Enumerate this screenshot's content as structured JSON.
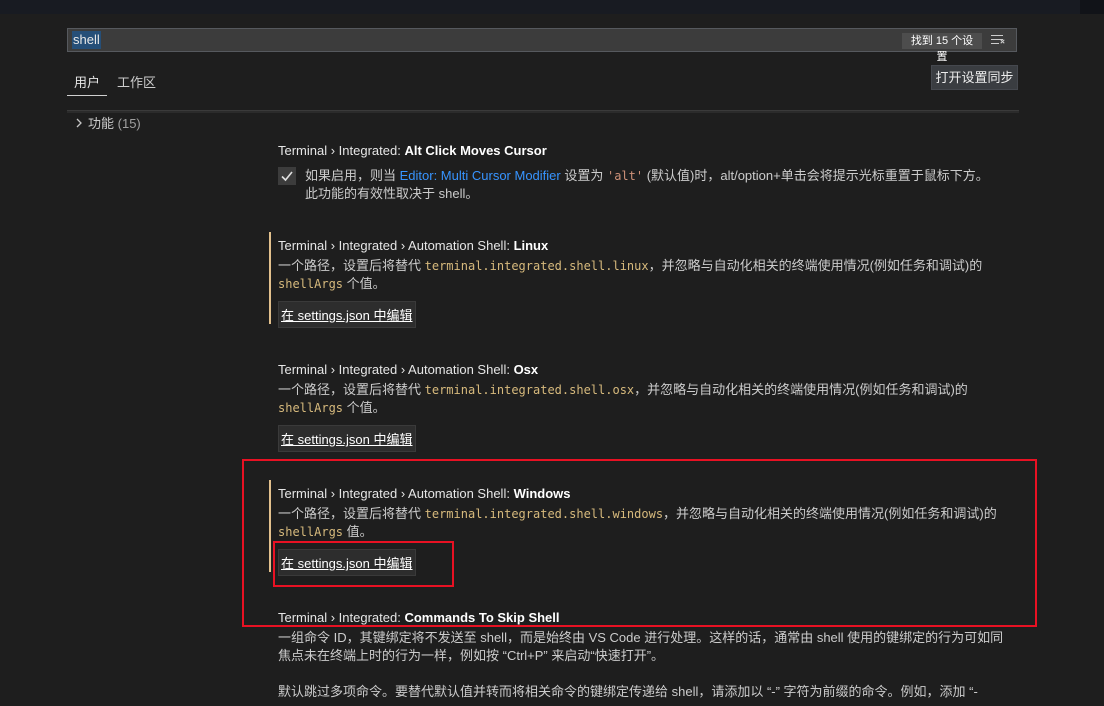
{
  "search": {
    "value": "shell",
    "result_count": "找到 15 个设置",
    "filter_icon": "filter-list-icon"
  },
  "tabs": [
    {
      "label": "用户"
    },
    {
      "label": "工作区"
    }
  ],
  "sync_button": "打开设置同步",
  "tree": {
    "label": "功能",
    "count": "(15)",
    "icon": "chevron-right-icon"
  },
  "settings": [
    {
      "title_prefix": "Terminal › Integrated: ",
      "title_name": "Alt Click Moves Cursor",
      "checked": true,
      "desc_1": "如果启用，则当 ",
      "desc_link": "Editor: Multi Cursor Modifier",
      "desc_2": " 设置为 ",
      "desc_code": "'alt'",
      "desc_3": " (默认值)时，alt/option+单击会将提示光标重置于鼠标下方。",
      "desc_4": "此功能的有效性取决于 shell。"
    },
    {
      "title_prefix": "Terminal › Integrated › Automation Shell: ",
      "title_name": "Linux",
      "desc_1": "一个路径，设置后将替代 ",
      "desc_code": "terminal.integrated.shell.linux",
      "desc_2": "，并忽略与自动化相关的终端使用情况(例如任务和调试)的",
      "desc_code2": "shellArgs",
      "desc_3": " 个值。",
      "edit_link": "在 settings.json 中编辑"
    },
    {
      "title_prefix": "Terminal › Integrated › Automation Shell: ",
      "title_name": "Osx",
      "desc_1": "一个路径，设置后将替代 ",
      "desc_code": "terminal.integrated.shell.osx",
      "desc_2": "，并忽略与自动化相关的终端使用情况(例如任务和调试)的",
      "desc_code2": "shellArgs",
      "desc_3": " 个值。",
      "edit_link": "在 settings.json 中编辑"
    },
    {
      "title_prefix": "Terminal › Integrated › Automation Shell: ",
      "title_name": "Windows",
      "desc_1": "一个路径，设置后将替代 ",
      "desc_code": "terminal.integrated.shell.windows",
      "desc_2": "，并忽略与自动化相关的终端使用情况(例如任务和调试)的",
      "desc_code2": "shellArgs",
      "desc_3": " 值。",
      "edit_link": "在 settings.json 中编辑"
    },
    {
      "title_prefix": "Terminal › Integrated: ",
      "title_name": "Commands To Skip Shell",
      "desc_1": "一组命令 ID，其键绑定将不发送至 shell，而是始终由 VS Code 进行处理。这样的话，通常由 shell 使用的键绑定的行为可如同",
      "desc_2": "焦点未在终端上时的行为一样，例如按 “Ctrl+P” 来启动“快速打开”。",
      "desc_3": "默认跳过多项命令。要替代默认值并转而将相关命令的键绑定传递给 shell，请添加以 “-” 字符为前缀的命令。例如，添加 “-"
    }
  ],
  "colors": {
    "annotation": "#e81123",
    "modified_bar": "#e2c08d",
    "link": "#3794ff"
  }
}
